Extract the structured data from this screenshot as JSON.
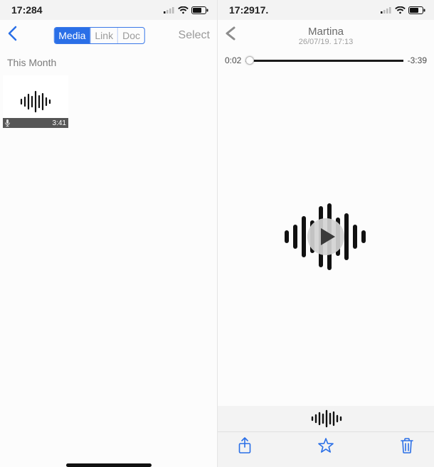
{
  "left": {
    "status": {
      "time": "17:284"
    },
    "nav": {
      "tabs": [
        "Media",
        "Link",
        "Doc"
      ],
      "selected_index": 0,
      "right_label": "Select"
    },
    "section": "This Month",
    "items": [
      {
        "duration": "3:41"
      }
    ]
  },
  "right": {
    "status": {
      "time": "17:2917."
    },
    "nav": {
      "title": "Martina",
      "subtitle": "26/07/19. 17:13"
    },
    "player": {
      "elapsed": "0:02",
      "remaining": "-3:39",
      "progress_pct": 1
    }
  }
}
